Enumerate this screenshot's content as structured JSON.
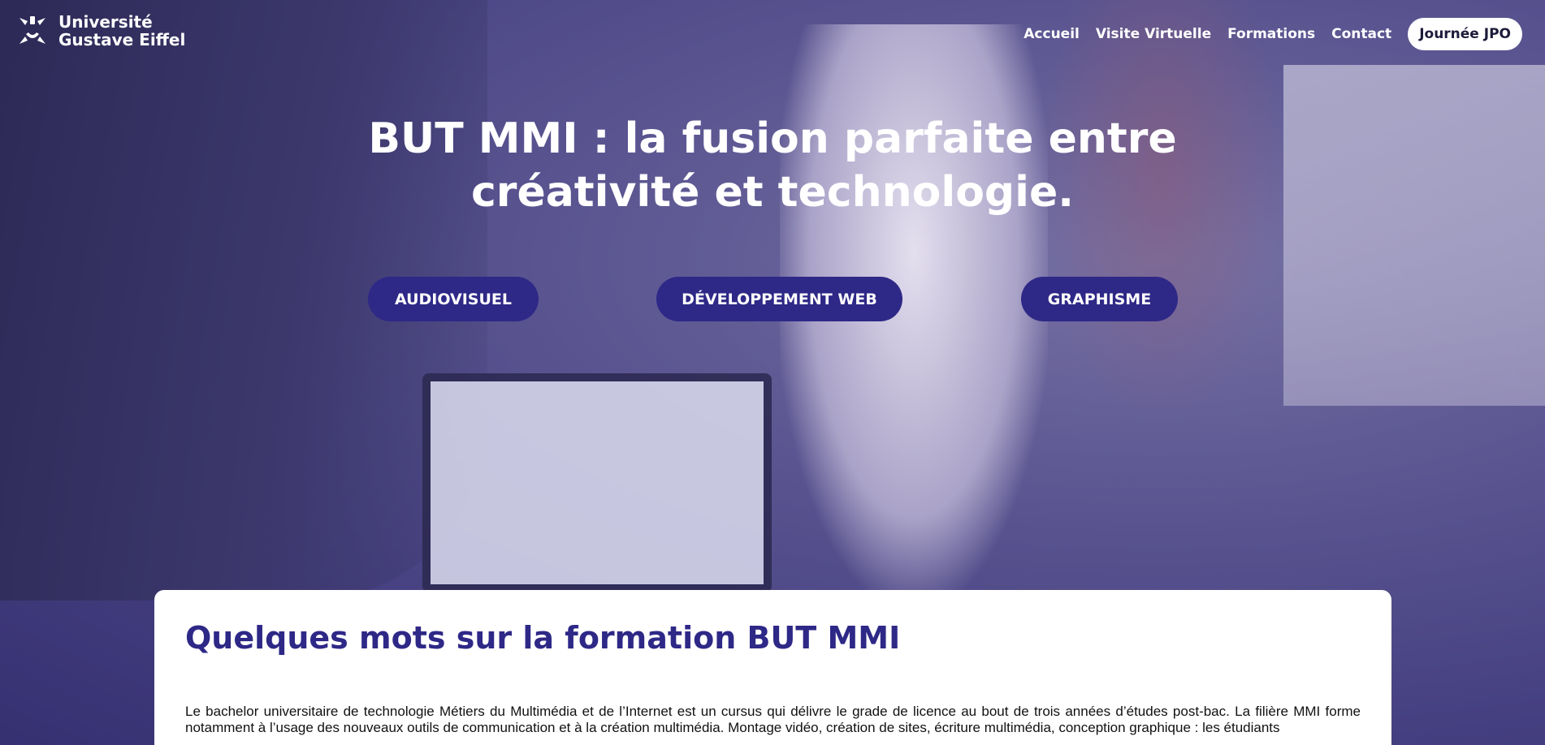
{
  "brand": {
    "line1": "Université",
    "line2": "Gustave Eiffel"
  },
  "nav": {
    "items": [
      "Accueil",
      "Visite Virtuelle",
      "Formations",
      "Contact"
    ],
    "cta": "Journée JPO"
  },
  "hero": {
    "title_line1": "BUT MMI : la fusion parfaite entre",
    "title_line2": "créativité et technologie.",
    "buttons": [
      "AUDIOVISUEL",
      "DÉVELOPPEMENT WEB",
      "GRAPHISME"
    ]
  },
  "intro": {
    "heading": "Quelques mots sur la formation BUT MMI",
    "paragraph": "Le bachelor universitaire de technologie Métiers du Multimédia et de l’Internet est un cursus qui délivre le grade de licence au bout de trois années d’études post-bac. La filière MMI forme notamment à l’usage des nouveaux outils de communication et à la création multimédia. Montage vidéo, création de sites, écriture multimédia, conception graphique : les étudiants"
  },
  "colors": {
    "accent": "#2e2887",
    "overlay": "#322d78",
    "text": "#111111"
  }
}
